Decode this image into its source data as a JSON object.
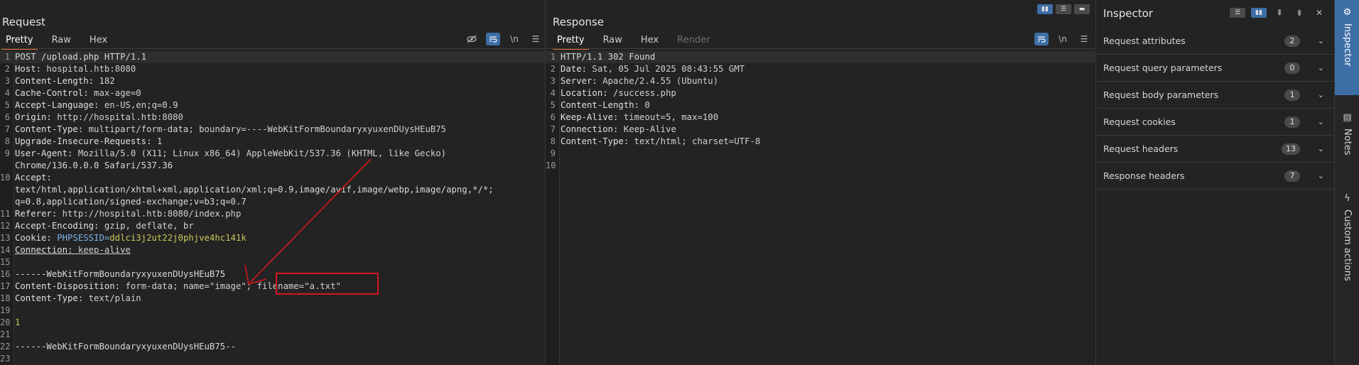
{
  "request": {
    "title": "Request",
    "tabs": [
      "Pretty",
      "Raw",
      "Hex"
    ],
    "active_tab": "Pretty",
    "icons": [
      "eye-slash-icon",
      "wrap-icon",
      "newline-icon",
      "menu-icon"
    ],
    "lines": [
      {
        "n": "1",
        "text": "POST /upload.php HTTP/1.1"
      },
      {
        "n": "2",
        "name": "Host:",
        "value": " hospital.htb:8080"
      },
      {
        "n": "3",
        "name": "Content-Length:",
        "value": " 182"
      },
      {
        "n": "4",
        "name": "Cache-Control:",
        "value": " max-age=0"
      },
      {
        "n": "5",
        "name": "Accept-Language:",
        "value": " en-US,en;q=0.9"
      },
      {
        "n": "6",
        "name": "Origin:",
        "value": " http://hospital.htb:8080"
      },
      {
        "n": "7",
        "name": "Content-Type:",
        "value": " multipart/form-data; boundary=----WebKitFormBoundaryxyuxenDUysHEuB75"
      },
      {
        "n": "8",
        "name": "Upgrade-Insecure-Requests:",
        "value": " 1"
      },
      {
        "n": "9",
        "name": "User-Agent:",
        "value": " Mozilla/5.0 (X11; Linux x86_64) AppleWebKit/537.36 (KHTML, like Gecko)"
      },
      {
        "n": "",
        "text": "Chrome/136.0.0.0 Safari/537.36"
      },
      {
        "n": "10",
        "name": "Accept:",
        "value": ""
      },
      {
        "n": "",
        "text": "text/html,application/xhtml+xml,application/xml;q=0.9,image/avif,image/webp,image/apng,*/*;"
      },
      {
        "n": "",
        "text": "q=0.8,application/signed-exchange;v=b3;q=0.7"
      },
      {
        "n": "11",
        "name": "Referer:",
        "value": " http://hospital.htb:8080/index.php"
      },
      {
        "n": "12",
        "name": "Accept-Encoding:",
        "value": " gzip, deflate, br"
      },
      {
        "n": "13",
        "name": "Cookie:",
        "cookie_key": " PHPSESSID=",
        "cookie_val": "ddlci3j2ut22j0phjve4hc141k"
      },
      {
        "n": "14",
        "name": "Connection:",
        "value": " keep-alive",
        "underline": true
      },
      {
        "n": "15",
        "text": ""
      },
      {
        "n": "16",
        "text": "------WebKitFormBoundaryxyuxenDUysHEuB75"
      },
      {
        "n": "17",
        "name": "Content-Disposition:",
        "value": " form-data; name=\"image\"; filename=\"a.txt\""
      },
      {
        "n": "18",
        "name": "Content-Type:",
        "value": " text/plain"
      },
      {
        "n": "19",
        "text": ""
      },
      {
        "n": "20",
        "num": "1"
      },
      {
        "n": "21",
        "text": ""
      },
      {
        "n": "22",
        "text": "------WebKitFormBoundaryxyuxenDUysHEuB75--"
      },
      {
        "n": "23",
        "text": ""
      }
    ]
  },
  "response": {
    "title": "Response",
    "tabs": [
      "Pretty",
      "Raw",
      "Hex",
      "Render"
    ],
    "active_tab": "Pretty",
    "lines": [
      {
        "n": "1",
        "text": "HTTP/1.1 302 Found"
      },
      {
        "n": "2",
        "name": "Date:",
        "value": " Sat, 05 Jul 2025 08:43:55 GMT"
      },
      {
        "n": "3",
        "name": "Server:",
        "value": " Apache/2.4.55 (Ubuntu)"
      },
      {
        "n": "4",
        "name": "Location:",
        "value": " /success.php"
      },
      {
        "n": "5",
        "name": "Content-Length:",
        "value": " 0"
      },
      {
        "n": "6",
        "name": "Keep-Alive:",
        "value": " timeout=5, max=100"
      },
      {
        "n": "7",
        "name": "Connection:",
        "value": " Keep-Alive"
      },
      {
        "n": "8",
        "name": "Content-Type:",
        "value": " text/html; charset=UTF-8"
      },
      {
        "n": "9",
        "text": ""
      },
      {
        "n": "10",
        "text": ""
      }
    ]
  },
  "inspector": {
    "title": "Inspector",
    "sections": [
      {
        "label": "Request attributes",
        "count": "2"
      },
      {
        "label": "Request query parameters",
        "count": "0"
      },
      {
        "label": "Request body parameters",
        "count": "1"
      },
      {
        "label": "Request cookies",
        "count": "1"
      },
      {
        "label": "Request headers",
        "count": "13"
      },
      {
        "label": "Response headers",
        "count": "7"
      }
    ]
  },
  "side_rail": {
    "items": [
      "Inspector",
      "Notes",
      "Custom actions"
    ]
  },
  "colors": {
    "accent_tab": "#e8732c",
    "active_blue": "#3d6ea6",
    "annotation_red": "#d4171e"
  }
}
